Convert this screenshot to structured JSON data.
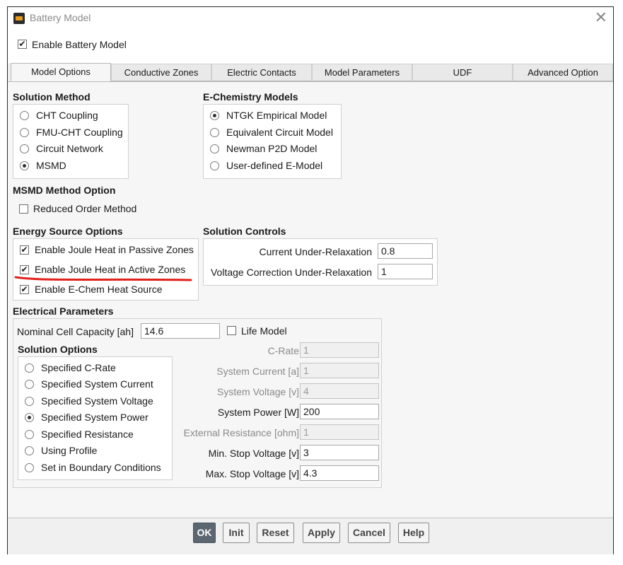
{
  "window": {
    "title": "Battery Model"
  },
  "enable_battery_model": {
    "label": "Enable Battery Model",
    "checked": true
  },
  "tabs": [
    {
      "label": "Model Options",
      "active": true
    },
    {
      "label": "Conductive Zones",
      "active": false
    },
    {
      "label": "Electric Contacts",
      "active": false
    },
    {
      "label": "Model Parameters",
      "active": false
    },
    {
      "label": "UDF",
      "active": false
    },
    {
      "label": "Advanced Option",
      "active": false
    }
  ],
  "solution_method": {
    "header": "Solution Method",
    "options": [
      "CHT Coupling",
      "FMU-CHT Coupling",
      "Circuit Network",
      "MSMD"
    ],
    "selected": "MSMD"
  },
  "echem_models": {
    "header": "E-Chemistry Models",
    "options": [
      "NTGK Empirical Model",
      "Equivalent Circuit Model",
      "Newman P2D Model",
      "User-defined E-Model"
    ],
    "selected": "NTGK Empirical Model"
  },
  "msmd_method": {
    "header": "MSMD Method Option",
    "reduced_order": {
      "label": "Reduced Order Method",
      "checked": false
    }
  },
  "energy_source": {
    "header": "Energy Source Options",
    "items": [
      {
        "label": "Enable Joule Heat in Passive Zones",
        "checked": true
      },
      {
        "label": "Enable Joule Heat in Active Zones",
        "checked": true
      },
      {
        "label": "Enable E-Chem Heat Source",
        "checked": true
      }
    ]
  },
  "solution_controls": {
    "header": "Solution Controls",
    "current_relax": {
      "label": "Current Under-Relaxation",
      "value": "0.8"
    },
    "voltage_relax": {
      "label": "Voltage Correction Under-Relaxation",
      "value": "1"
    }
  },
  "electrical": {
    "header": "Electrical Parameters",
    "capacity": {
      "label": "Nominal Cell Capacity [ah]",
      "value": "14.6"
    },
    "life_model": {
      "label": "Life Model",
      "checked": false
    },
    "solution_options_header": "Solution Options",
    "solution_options": [
      "Specified C-Rate",
      "Specified System Current",
      "Specified System Voltage",
      "Specified System Power",
      "Specified Resistance",
      "Using Profile",
      "Set in Boundary Conditions"
    ],
    "selected_option": "Specified System Power",
    "fields": {
      "c_rate": {
        "label": "C-Rate",
        "value": "1",
        "enabled": false
      },
      "system_current": {
        "label": "System Current [a]",
        "value": "1",
        "enabled": false
      },
      "system_voltage": {
        "label": "System Voltage [v]",
        "value": "4",
        "enabled": false
      },
      "system_power": {
        "label": "System Power [W]",
        "value": "200",
        "enabled": true
      },
      "external_resistance": {
        "label": "External Resistance [ohm]",
        "value": "1",
        "enabled": false
      },
      "min_stop_voltage": {
        "label": "Min. Stop Voltage [v]",
        "value": "3",
        "enabled": true
      },
      "max_stop_voltage": {
        "label": "Max. Stop Voltage [v]",
        "value": "4.3",
        "enabled": true
      }
    }
  },
  "buttons": {
    "ok": "OK",
    "init": "Init",
    "reset": "Reset",
    "apply": "Apply",
    "cancel": "Cancel",
    "help": "Help"
  },
  "colors": {
    "annotation_underline": "#e0201b",
    "primary_button": "#5b6670"
  }
}
